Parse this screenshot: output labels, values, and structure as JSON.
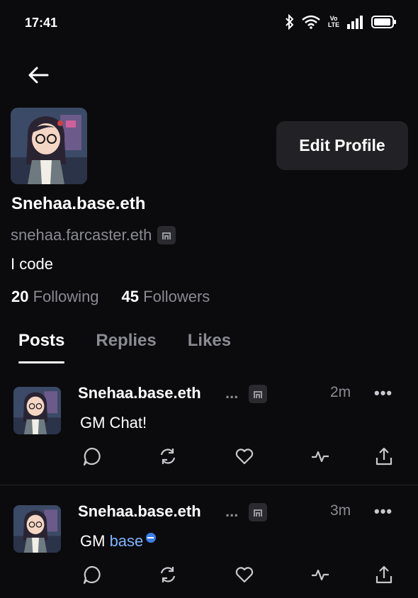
{
  "status": {
    "time": "17:41",
    "network_label": "Vo LTE"
  },
  "profile": {
    "display_name": "Snehaa.base.eth",
    "username": "snehaa.farcaster.eth",
    "bio": "I code",
    "following_count": "20",
    "following_label": "Following",
    "followers_count": "45",
    "followers_label": "Followers",
    "edit_label": "Edit Profile"
  },
  "tabs": [
    {
      "label": "Posts",
      "active": true
    },
    {
      "label": "Replies",
      "active": false
    },
    {
      "label": "Likes",
      "active": false
    }
  ],
  "posts": [
    {
      "author": "Snehaa.base.eth",
      "truncation": "...",
      "time": "2m",
      "more": "•••",
      "text": "GM Chat!",
      "mention": ""
    },
    {
      "author": "Snehaa.base.eth",
      "truncation": "...",
      "time": "3m",
      "more": "•••",
      "text": "GM ",
      "mention": "base"
    }
  ],
  "colors": {
    "background": "#0b0b0d",
    "muted": "#8a8a93",
    "link": "#7fb3ff",
    "button_bg": "#222226"
  }
}
